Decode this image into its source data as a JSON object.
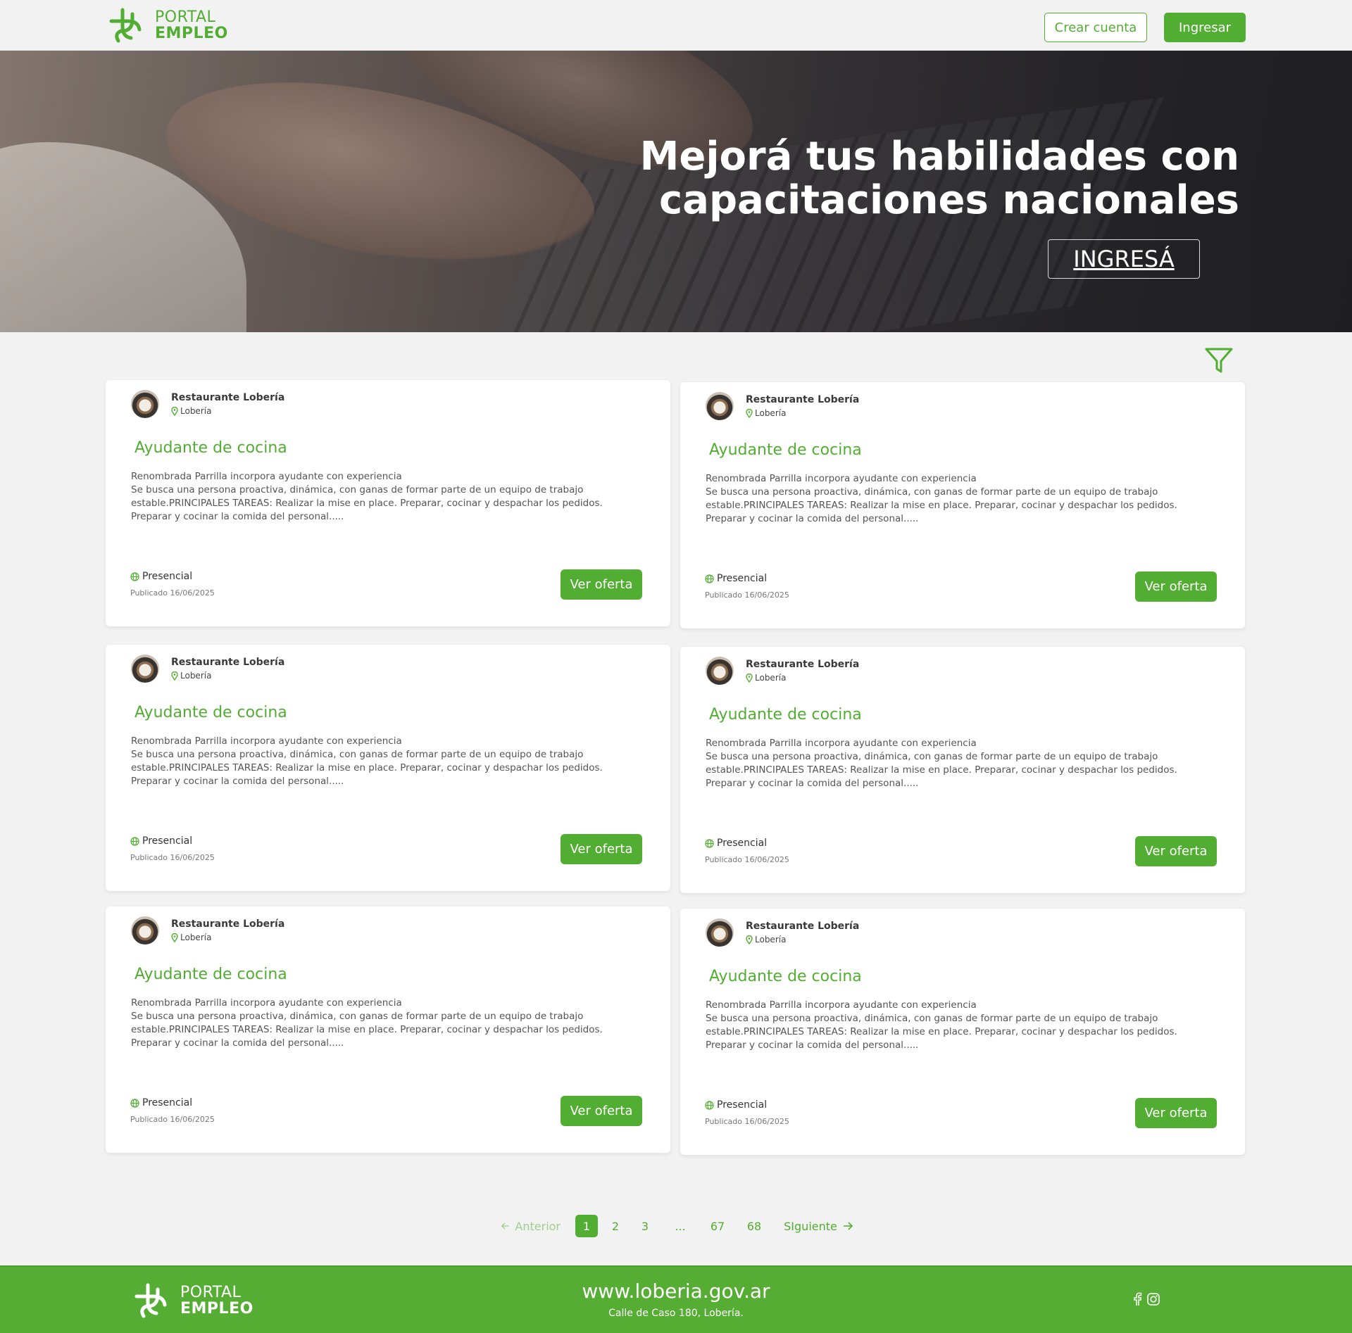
{
  "header": {
    "logo_line1": "PORTAL",
    "logo_line2": "EMPLEO",
    "create_account": "Crear cuenta",
    "login": "Ingresar"
  },
  "hero": {
    "title_line1": "Mejorá tus habilidades con",
    "title_line2": "capacitaciones nacionales",
    "cta": "INGRESÁ"
  },
  "jobs": [
    {
      "company": "Restaurante Lobería",
      "location": "Lobería",
      "title": "Ayudante de cocina",
      "description": [
        "Renombrada Parrilla incorpora ayudante con experiencia",
        "Se busca una persona proactiva, dinámica, con ganas de formar parte de un equipo de trabajo",
        "estable.PRINCIPALES TAREAS: Realizar la mise en place. Preparar, cocinar y despachar los pedidos.",
        "Preparar y cocinar la comida del personal....."
      ],
      "modality": "Presencial",
      "published": "Publicado 16/06/2025",
      "button": "Ver oferta"
    },
    {
      "company": "Restaurante Lobería",
      "location": "Lobería",
      "title": "Ayudante de cocina",
      "description": [
        "Renombrada Parrilla incorpora ayudante con experiencia",
        "Se busca una persona proactiva, dinámica, con ganas de formar parte de un equipo de trabajo",
        "estable.PRINCIPALES TAREAS: Realizar la mise en place. Preparar, cocinar y despachar los pedidos.",
        "Preparar y cocinar la comida del personal....."
      ],
      "modality": "Presencial",
      "published": "Publicado 16/06/2025",
      "button": "Ver oferta"
    },
    {
      "company": "Restaurante Lobería",
      "location": "Lobería",
      "title": "Ayudante de cocina",
      "description": [
        "Renombrada Parrilla incorpora ayudante con experiencia",
        "Se busca una persona proactiva, dinámica, con ganas de formar parte de un equipo de trabajo",
        "estable.PRINCIPALES TAREAS: Realizar la mise en place. Preparar, cocinar y despachar los pedidos.",
        "Preparar y cocinar la comida del personal....."
      ],
      "modality": "Presencial",
      "published": "Publicado 16/06/2025",
      "button": "Ver oferta"
    },
    {
      "company": "Restaurante Lobería",
      "location": "Lobería",
      "title": "Ayudante de cocina",
      "description": [
        "Renombrada Parrilla incorpora ayudante con experiencia",
        "Se busca una persona proactiva, dinámica, con ganas de formar parte de un equipo de trabajo",
        "estable.PRINCIPALES TAREAS: Realizar la mise en place. Preparar, cocinar y despachar los pedidos.",
        "Preparar y cocinar la comida del personal....."
      ],
      "modality": "Presencial",
      "published": "Publicado 16/06/2025",
      "button": "Ver oferta"
    },
    {
      "company": "Restaurante Lobería",
      "location": "Lobería",
      "title": "Ayudante de cocina",
      "description": [
        "Renombrada Parrilla incorpora ayudante con experiencia",
        "Se busca una persona proactiva, dinámica, con ganas de formar parte de un equipo de trabajo",
        "estable.PRINCIPALES TAREAS: Realizar la mise en place. Preparar, cocinar y despachar los pedidos.",
        "Preparar y cocinar la comida del personal....."
      ],
      "modality": "Presencial",
      "published": "Publicado 16/06/2025",
      "button": "Ver oferta"
    },
    {
      "company": "Restaurante Lobería",
      "location": "Lobería",
      "title": "Ayudante de cocina",
      "description": [
        "Renombrada Parrilla incorpora ayudante con experiencia",
        "Se busca una persona proactiva, dinámica, con ganas de formar parte de un equipo de trabajo",
        "estable.PRINCIPALES TAREAS: Realizar la mise en place. Preparar, cocinar y despachar los pedidos.",
        "Preparar y cocinar la comida del personal....."
      ],
      "modality": "Presencial",
      "published": "Publicado 16/06/2025",
      "button": "Ver oferta"
    }
  ],
  "pagination": {
    "prev": "Anterior",
    "pages": [
      "1",
      "2",
      "3",
      "...",
      "67",
      "68"
    ],
    "current": "1",
    "next": "SIguiente"
  },
  "footer": {
    "logo_line1": "PORTAL",
    "logo_line2": "EMPLEO",
    "website": "www.loberia.gov.ar",
    "address": "Calle de Caso 180, Lobería."
  },
  "icons": {
    "brand": "portal-empleo-logo",
    "filter": "filter-icon",
    "location": "map-pin-icon",
    "modality": "globe-icon",
    "facebook": "facebook-icon",
    "instagram": "instagram-icon"
  },
  "colors": {
    "accent": "#52ae32",
    "footer_bg": "#55ad33",
    "page_bg": "#f2f2f2"
  }
}
